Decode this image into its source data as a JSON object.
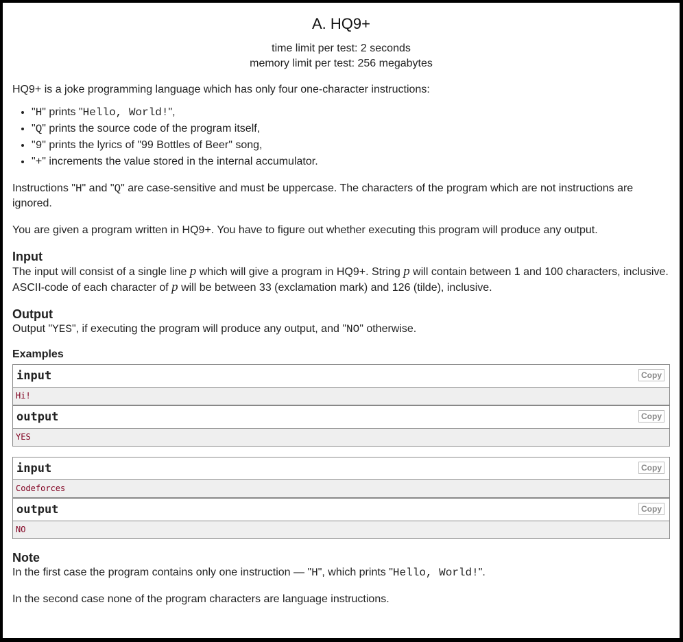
{
  "title": "A. HQ9+",
  "time_limit": "time limit per test: 2 seconds",
  "memory_limit": "memory limit per test: 256 megabytes",
  "intro": "HQ9+ is a joke programming language which has only four one-character instructions:",
  "items": [
    {
      "pre": "\"",
      "code": "H",
      "mid": "\" prints \"",
      "code2": "Hello, World!",
      "post": "\","
    },
    {
      "pre": "\"",
      "code": "Q",
      "mid": "\" prints the source code of the program itself,"
    },
    {
      "pre": "\"",
      "code": "9",
      "mid": "\" prints the lyrics of \"99 Bottles of Beer\" song,"
    },
    {
      "pre": "\"",
      "code": "+",
      "mid": "\" increments the value stored in the internal accumulator."
    }
  ],
  "p1": {
    "a": "Instructions \"",
    "h": "H",
    "b": "\" and \"",
    "q": "Q",
    "c": "\" are case-sensitive and must be uppercase. The characters of the program which are not instructions are ignored."
  },
  "p2": "You are given a program written in HQ9+. You have to figure out whether executing this program will produce any output.",
  "input_title": "Input",
  "input": {
    "a": "The input will consist of a single line ",
    "p": "p",
    "b": " which will give a program in HQ9+. String ",
    "c": " will contain between 1 and 100 characters, inclusive.",
    "d": "ASCII-code of each character of ",
    "e": " will be between 33 (exclamation mark) and 126 (tilde), inclusive."
  },
  "output_title": "Output",
  "output": {
    "a": "Output \"",
    "yes": "YES",
    "b": "\", if executing the program will produce any output, and \"",
    "no": "NO",
    "c": "\" otherwise."
  },
  "examples_title": "Examples",
  "input_label": "input",
  "output_label": "output",
  "copy": "Copy",
  "examples": [
    {
      "in": "Hi!",
      "out": "YES"
    },
    {
      "in": "Codeforces",
      "out": "NO"
    }
  ],
  "note_title": "Note",
  "note1": {
    "a": "In the first case the program contains only one instruction — \"",
    "h": "H",
    "b": "\", which prints \"",
    "hw": "Hello, World!",
    "c": "\"."
  },
  "note2": "In the second case none of the program characters are language instructions."
}
